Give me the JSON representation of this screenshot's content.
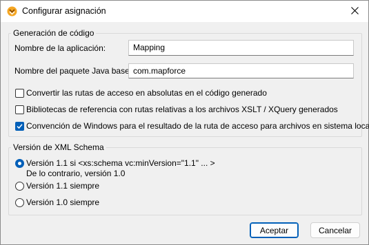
{
  "window": {
    "title": "Configurar asignación",
    "icons": {
      "app": "mapforce-app-icon",
      "close": "close-icon"
    }
  },
  "code_generation": {
    "legend": "Generación de código",
    "app_name_label": "Nombre de la aplicación:",
    "app_name_value": "Mapping",
    "java_package_label": "Nombre del paquete Java base:",
    "java_package_value": "com.mapforce",
    "options": [
      {
        "label": "Convertir las rutas de acceso en absolutas en el código generado",
        "checked": false
      },
      {
        "label": "Bibliotecas de referencia con rutas relativas a los archivos XSLT / XQuery generados",
        "checked": false
      },
      {
        "label": "Convención de Windows para el resultado de la ruta de acceso para archivos en sistema local",
        "checked": true
      }
    ]
  },
  "xml_schema_version": {
    "legend": "Versión de XML Schema",
    "options": [
      {
        "line1": "Versión 1.1 si <xs:schema vc:minVersion=\"1.1\" ... >",
        "line2": "De lo contrario, versión 1.0",
        "selected": true
      },
      {
        "line1": "Versión 1.1 siempre",
        "selected": false
      },
      {
        "line1": "Versión 1.0 siempre",
        "selected": false
      }
    ]
  },
  "buttons": {
    "ok": "Aceptar",
    "cancel": "Cancelar"
  },
  "colors": {
    "accent": "#005fb8",
    "background": "#f0f0f0",
    "group_border": "#d9d9d9"
  }
}
